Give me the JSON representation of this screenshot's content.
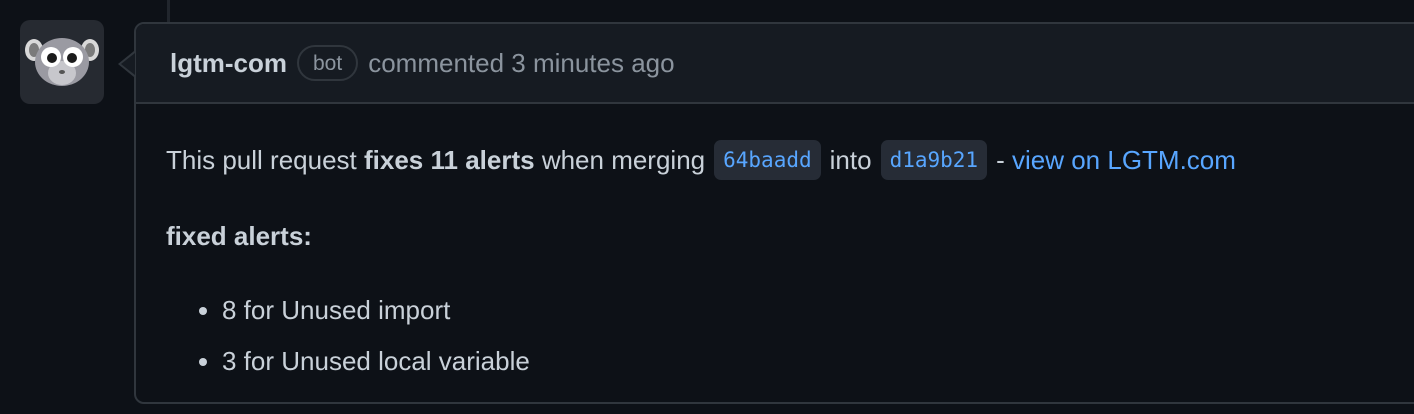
{
  "comment": {
    "author": "lgtm-com",
    "badge": "bot",
    "meta": "commented 3 minutes ago",
    "body": {
      "intro": "This pull request",
      "fixes_count": "fixes 11 alerts",
      "when_merging": "when merging",
      "head_commit": "64baadd",
      "into": "into",
      "base_commit": "d1a9b21",
      "dash": "-",
      "view_link": "view on LGTM.com",
      "heading": "fixed alerts:",
      "alerts": [
        "8 for Unused import",
        "3 for Unused local variable"
      ]
    }
  },
  "colors": {
    "background": "#0d1117",
    "header_bg": "#161b22",
    "border": "#30363d",
    "link": "#58a6ff",
    "muted": "#8b949e"
  },
  "icons": {
    "avatar": "lgtm-lemur-avatar-icon"
  }
}
